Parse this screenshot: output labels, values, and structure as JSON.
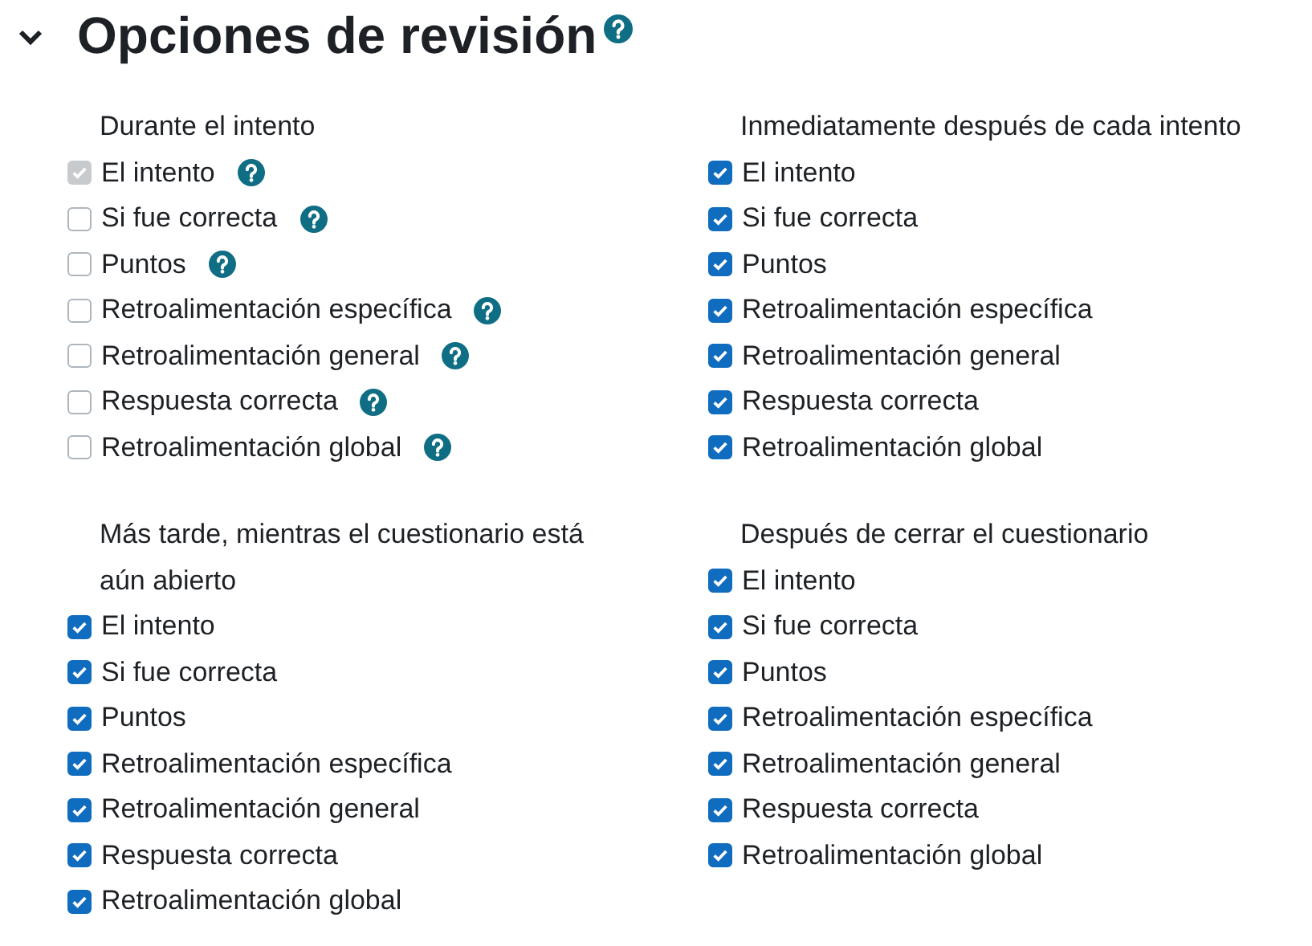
{
  "section": {
    "title": "Opciones de revisión",
    "expanded": true,
    "help": true
  },
  "groups": [
    {
      "heading": "Durante el intento",
      "items": [
        {
          "label": "El intento",
          "checked": true,
          "disabled": true,
          "help": true
        },
        {
          "label": "Si fue correcta",
          "checked": false,
          "disabled": false,
          "help": true
        },
        {
          "label": "Puntos",
          "checked": false,
          "disabled": false,
          "help": true
        },
        {
          "label": "Retroalimentación específica",
          "checked": false,
          "disabled": false,
          "help": true
        },
        {
          "label": "Retroalimentación general",
          "checked": false,
          "disabled": false,
          "help": true
        },
        {
          "label": "Respuesta correcta",
          "checked": false,
          "disabled": false,
          "help": true
        },
        {
          "label": "Retroalimentación global",
          "checked": false,
          "disabled": false,
          "help": true
        }
      ]
    },
    {
      "heading": "Inmediatamente después de cada intento",
      "items": [
        {
          "label": "El intento",
          "checked": true,
          "disabled": false,
          "help": false
        },
        {
          "label": "Si fue correcta",
          "checked": true,
          "disabled": false,
          "help": false
        },
        {
          "label": "Puntos",
          "checked": true,
          "disabled": false,
          "help": false
        },
        {
          "label": "Retroalimentación específica",
          "checked": true,
          "disabled": false,
          "help": false
        },
        {
          "label": "Retroalimentación general",
          "checked": true,
          "disabled": false,
          "help": false
        },
        {
          "label": "Respuesta correcta",
          "checked": true,
          "disabled": false,
          "help": false
        },
        {
          "label": "Retroalimentación global",
          "checked": true,
          "disabled": false,
          "help": false
        }
      ]
    },
    {
      "heading": "Más tarde, mientras el cuestionario está aún abierto",
      "items": [
        {
          "label": "El intento",
          "checked": true,
          "disabled": false,
          "help": false
        },
        {
          "label": "Si fue correcta",
          "checked": true,
          "disabled": false,
          "help": false
        },
        {
          "label": "Puntos",
          "checked": true,
          "disabled": false,
          "help": false
        },
        {
          "label": "Retroalimentación específica",
          "checked": true,
          "disabled": false,
          "help": false
        },
        {
          "label": "Retroalimentación general",
          "checked": true,
          "disabled": false,
          "help": false
        },
        {
          "label": "Respuesta correcta",
          "checked": true,
          "disabled": false,
          "help": false
        },
        {
          "label": "Retroalimentación global",
          "checked": true,
          "disabled": false,
          "help": false
        }
      ]
    },
    {
      "heading": "Después de cerrar el cuestionario",
      "items": [
        {
          "label": "El intento",
          "checked": true,
          "disabled": false,
          "help": false
        },
        {
          "label": "Si fue correcta",
          "checked": true,
          "disabled": false,
          "help": false
        },
        {
          "label": "Puntos",
          "checked": true,
          "disabled": false,
          "help": false
        },
        {
          "label": "Retroalimentación específica",
          "checked": true,
          "disabled": false,
          "help": false
        },
        {
          "label": "Retroalimentación general",
          "checked": true,
          "disabled": false,
          "help": false
        },
        {
          "label": "Respuesta correcta",
          "checked": true,
          "disabled": false,
          "help": false
        },
        {
          "label": "Retroalimentación global",
          "checked": true,
          "disabled": false,
          "help": false
        }
      ]
    }
  ]
}
